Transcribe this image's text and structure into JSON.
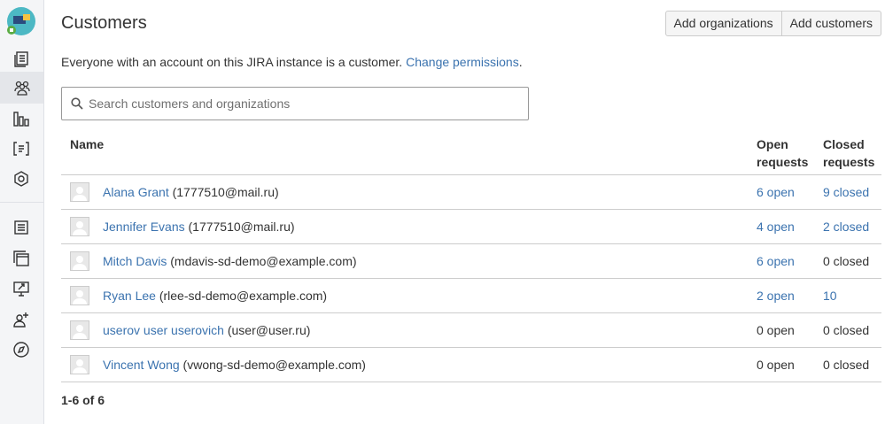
{
  "sidebar": {
    "logo": "service-desk-logo",
    "top_items": [
      {
        "icon": "queues-icon"
      },
      {
        "icon": "customers-icon",
        "active": true
      },
      {
        "icon": "reports-icon"
      },
      {
        "icon": "knowledge-base-icon"
      },
      {
        "icon": "settings-icon"
      }
    ],
    "bottom_items": [
      {
        "icon": "customer-channels-icon"
      },
      {
        "icon": "pages-icon"
      },
      {
        "icon": "raise-request-icon"
      },
      {
        "icon": "invite-team-icon"
      },
      {
        "icon": "getting-started-icon"
      }
    ]
  },
  "header": {
    "title": "Customers",
    "add_orgs_label": "Add organizations",
    "add_customers_label": "Add customers"
  },
  "info": {
    "text": "Everyone with an account on this JIRA instance is a customer.",
    "link": "Change permissions",
    "period": "."
  },
  "search": {
    "placeholder": "Search customers and organizations"
  },
  "table": {
    "headers": {
      "name": "Name",
      "open": "Open requests",
      "closed": "Closed requests"
    },
    "rows": [
      {
        "name": "Alana Grant",
        "email": "(1777510@mail.ru)",
        "open": "6 open",
        "open_link": true,
        "closed": "9 closed",
        "closed_link": true
      },
      {
        "name": "Jennifer Evans",
        "email": "(1777510@mail.ru)",
        "open": "4 open",
        "open_link": true,
        "closed": "2 closed",
        "closed_link": true
      },
      {
        "name": "Mitch Davis",
        "email": "(mdavis-sd-demo@example.com)",
        "open": "6 open",
        "open_link": true,
        "closed": "0 closed",
        "closed_link": false
      },
      {
        "name": "Ryan Lee",
        "email": "(rlee-sd-demo@example.com)",
        "open": "2 open",
        "open_link": true,
        "closed": "10",
        "closed_link": true
      },
      {
        "name": "userov user userovich",
        "email": "(user@user.ru)",
        "open": "0 open",
        "open_link": false,
        "closed": "0 closed",
        "closed_link": false
      },
      {
        "name": "Vincent Wong",
        "email": "(vwong-sd-demo@example.com)",
        "open": "0 open",
        "open_link": false,
        "closed": "0 closed",
        "closed_link": false
      }
    ]
  },
  "pager": {
    "text": "1-6 of 6"
  },
  "colors": {
    "link": "#3b73af",
    "border": "#cccccc",
    "sidebar_bg": "#f4f5f7"
  }
}
